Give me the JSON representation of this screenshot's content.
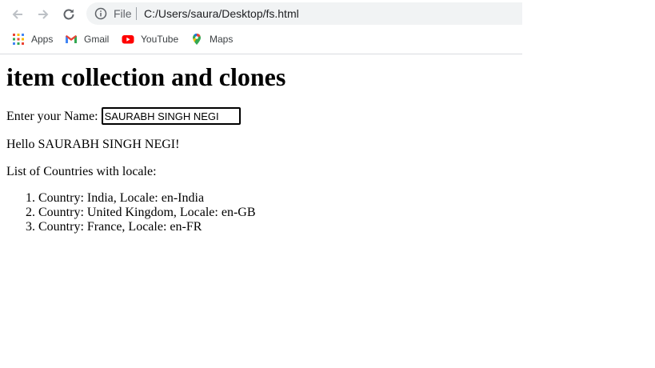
{
  "browser": {
    "omnibox": {
      "scheme_label": "File",
      "url": "C:/Users/saura/Desktop/fs.html"
    },
    "bookmarks": [
      {
        "label": "Apps",
        "icon": "apps-grid-icon"
      },
      {
        "label": "Gmail",
        "icon": "gmail-icon"
      },
      {
        "label": "YouTube",
        "icon": "youtube-icon"
      },
      {
        "label": "Maps",
        "icon": "maps-pin-icon"
      }
    ]
  },
  "page": {
    "title": "item collection and clones",
    "name_label": "Enter your Name:",
    "name_value": "SAURABH SINGH NEGI",
    "greeting": "Hello SAURABH SINGH NEGI!",
    "list_heading": "List of Countries with locale:",
    "countries": [
      "Country: India, Locale: en-India",
      "Country: United Kingdom, Locale: en-GB",
      "Country: France, Locale: en-FR"
    ]
  }
}
